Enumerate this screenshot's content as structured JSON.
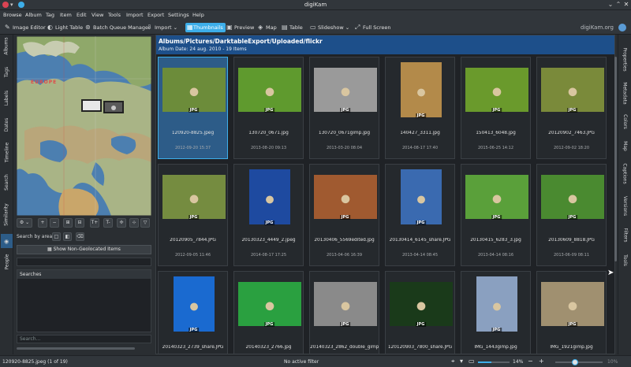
{
  "window": {
    "title": "digiKam"
  },
  "menubar": {
    "items": [
      "Browse",
      "Album",
      "Tag",
      "Item",
      "Edit",
      "View",
      "Tools",
      "Import",
      "Export",
      "Settings",
      "Help"
    ]
  },
  "toolbar": {
    "image_editor": "Image Editor",
    "light_table": "Light Table",
    "batch_queue": "Batch Queue Manager",
    "import": "Import",
    "thumbnails": "Thumbnails",
    "preview": "Preview",
    "map": "Map",
    "table": "Table",
    "slideshow": "Slideshow",
    "full_screen": "Full Screen",
    "brand": "digiKam.org"
  },
  "left_tabs": [
    "Albums",
    "Tags",
    "Labels",
    "Dates",
    "Timeline",
    "Search",
    "Similarity",
    "Map",
    "People"
  ],
  "map": {
    "region_label": "EUROPE"
  },
  "left_panel": {
    "search_by_area": "Search by area:",
    "show_non_geo": "Show Non-Geolocated Items",
    "searches_header": "Searches",
    "search_placeholder": "Search..."
  },
  "main": {
    "path": "Albums/Pictures/DarktableExport/Uploaded/flickr",
    "subtitle": "Album Date: 24 aug. 2010 - 19 Items"
  },
  "items": [
    {
      "name": "120920-8825.jpeg",
      "date": "2012-09-20 15:37",
      "badge": "JPG",
      "selected": true,
      "color": "#6c8c3a"
    },
    {
      "name": "130720_0671.jpg",
      "date": "2013-08-20 09:13",
      "badge": "JPG",
      "color": "#5f9a2e"
    },
    {
      "name": "130720_0671gimp.jpg",
      "date": "2013-03-20 08:04",
      "badge": "JPG",
      "color": "#9a9a9a"
    },
    {
      "name": "140427_3311.jpg",
      "date": "2014-08-17 17:40",
      "badge": "JPG",
      "color": "#b38a4a"
    },
    {
      "name": "150413_6048.jpg",
      "date": "2015-06-25 14:12",
      "badge": "JPG",
      "color": "#6a9a2c"
    },
    {
      "name": "20120902_7463.JPG",
      "date": "2012-09-02 18:20",
      "badge": "JPG",
      "color": "#7a8a3a"
    },
    {
      "name": "20120905_7844.JPG",
      "date": "2012-09-05 11:46",
      "badge": "JPG",
      "color": "#758c40"
    },
    {
      "name": "20130323_4449_2.jpeg",
      "date": "2014-08-17 17:25",
      "badge": "JPG",
      "color": "#1e4aa0"
    },
    {
      "name": "20130406_5569edited.jpg",
      "date": "2013-04-06 16:39",
      "badge": "JPG",
      "color": "#a05a30"
    },
    {
      "name": "20130414_6145_share.JPG",
      "date": "2013-04-14 08:45",
      "badge": "JPG",
      "color": "#3a6ab0"
    },
    {
      "name": "20130415_6283_3.jpg",
      "date": "2013-04-14 08:16",
      "badge": "JPG",
      "color": "#5aa03a"
    },
    {
      "name": "20130609_8818.JPG",
      "date": "2013-06-09 08:11",
      "badge": "JPG",
      "color": "#4a8a30"
    },
    {
      "name": "20140323_2739_share.JPG",
      "date": "",
      "badge": "JPG",
      "color": "#1a6ad0"
    },
    {
      "name": "20140323_2766.jpg",
      "date": "",
      "badge": "JPG",
      "color": "#2aa040"
    },
    {
      "name": "20140323_2862_double_gimp...",
      "date": "",
      "badge": "JPG",
      "color": "#8a8a8a"
    },
    {
      "name": "120120903_7800_share.JPG",
      "date": "",
      "badge": "JPG",
      "color": "#1a3a1a"
    },
    {
      "name": "IMG_1443gimp.jpg",
      "date": "",
      "badge": "JPG",
      "color": "#8aa0c0"
    },
    {
      "name": "IMG_1921gimp.jpg",
      "date": "",
      "badge": "JPG",
      "color": "#a09070"
    }
  ],
  "right_tabs": [
    "Properties",
    "Metadata",
    "Colors",
    "Map",
    "Captions",
    "Versions",
    "Filters",
    "Tools"
  ],
  "status": {
    "left": "120920-8825.jpeg (1 of 19)",
    "center": "No active filter",
    "zoom": "14%",
    "zoom_right": "10%"
  }
}
